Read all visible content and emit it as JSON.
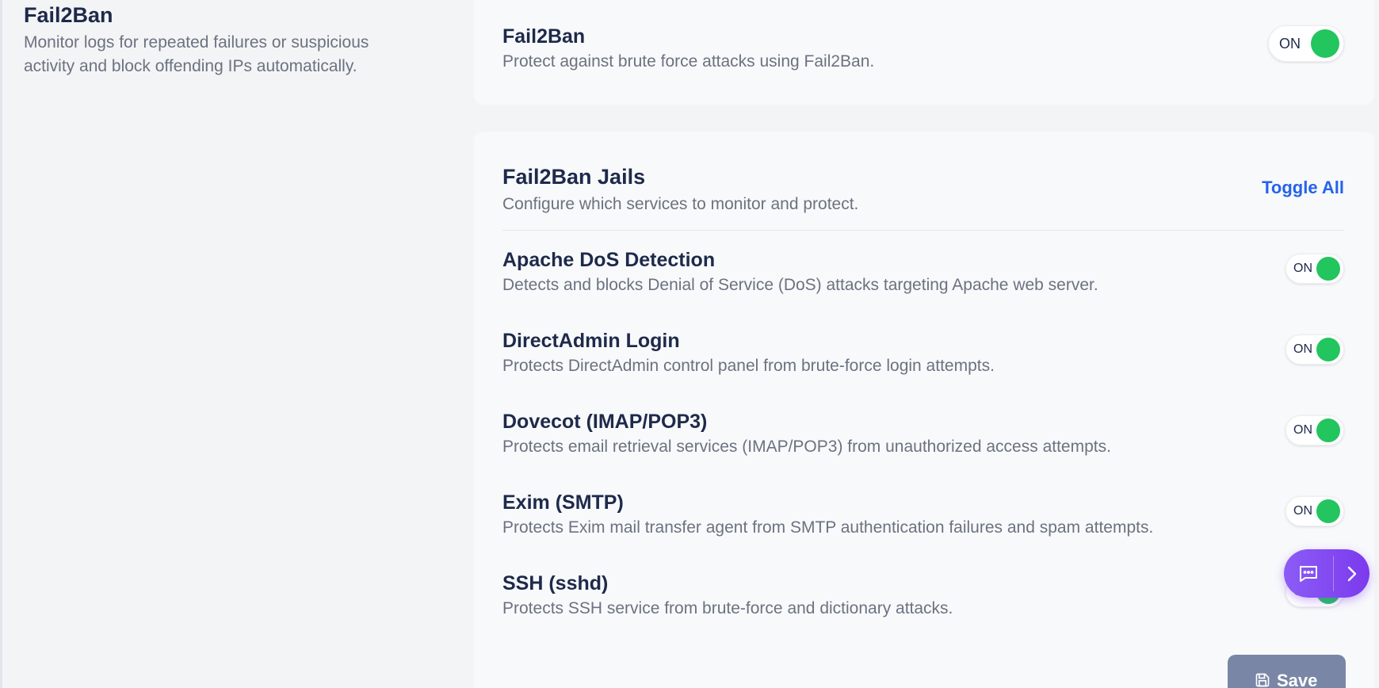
{
  "section": {
    "title": "Fail2Ban",
    "description_line1": "Monitor logs for repeated failures or suspicious",
    "description_line2": "activity and block offending IPs automatically."
  },
  "main_toggle": {
    "title": "Fail2Ban",
    "description": "Protect against brute force attacks using Fail2Ban.",
    "state": "ON"
  },
  "jails": {
    "title": "Fail2Ban Jails",
    "description": "Configure which services to monitor and protect.",
    "toggle_all_label": "Toggle All",
    "items": [
      {
        "title": "Apache DoS Detection",
        "description": "Detects and blocks Denial of Service (DoS) attacks targeting Apache web server.",
        "state": "ON"
      },
      {
        "title": "DirectAdmin Login",
        "description": "Protects DirectAdmin control panel from brute-force login attempts.",
        "state": "ON"
      },
      {
        "title": "Dovecot (IMAP/POP3)",
        "description": "Protects email retrieval services (IMAP/POP3) from unauthorized access attempts.",
        "state": "ON"
      },
      {
        "title": "Exim (SMTP)",
        "description": "Protects Exim mail transfer agent from SMTP authentication failures and spam attempts.",
        "state": "ON"
      },
      {
        "title": "SSH (sshd)",
        "description": "Protects SSH service from brute-force and dictionary attacks.",
        "state": "ON"
      }
    ]
  },
  "save_label": "Save",
  "colors": {
    "toggle_on": "#22c55e",
    "link": "#2563eb",
    "save_button": "#7a86a6",
    "chat_widget": "#7c3aed"
  }
}
